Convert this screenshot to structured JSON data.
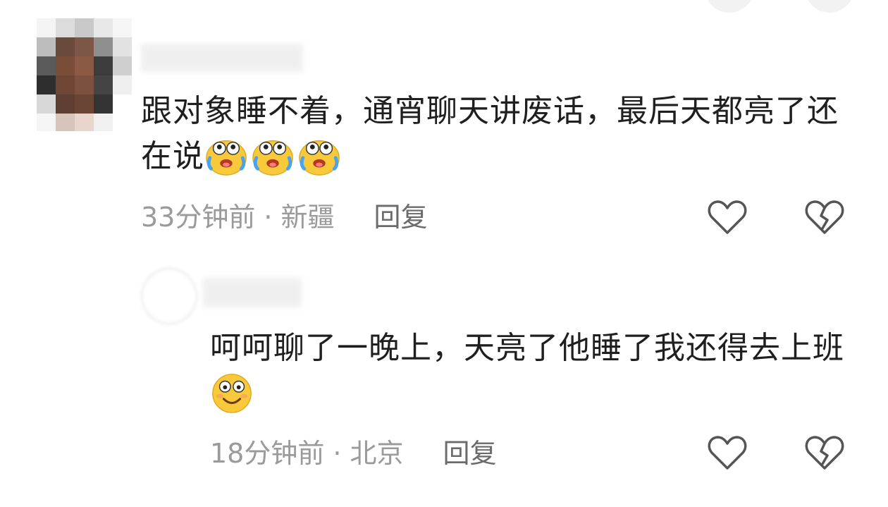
{
  "comments": [
    {
      "text": "跟对象睡不着，通宵聊天讲废话，最后天都亮了还在说",
      "emojis": [
        "crying-laughing-emoji",
        "crying-laughing-emoji",
        "crying-laughing-emoji"
      ],
      "time": "33分钟前",
      "location": "新疆",
      "reply_label": "回复"
    },
    {
      "text": "呵呵聊了一晚上，天亮了他睡了我还得去上班",
      "emojis": [
        "smiling-emoji"
      ],
      "time": "18分钟前",
      "location": "北京",
      "reply_label": "回复"
    }
  ],
  "separator": "·",
  "icons": {
    "like": "heart-outline-icon",
    "dislike": "broken-heart-icon"
  },
  "colors": {
    "text": "#1f1f1f",
    "meta": "#9a9a9a",
    "emoji_yellow": "#f7c93b",
    "tears_blue": "#4aa3f0"
  }
}
